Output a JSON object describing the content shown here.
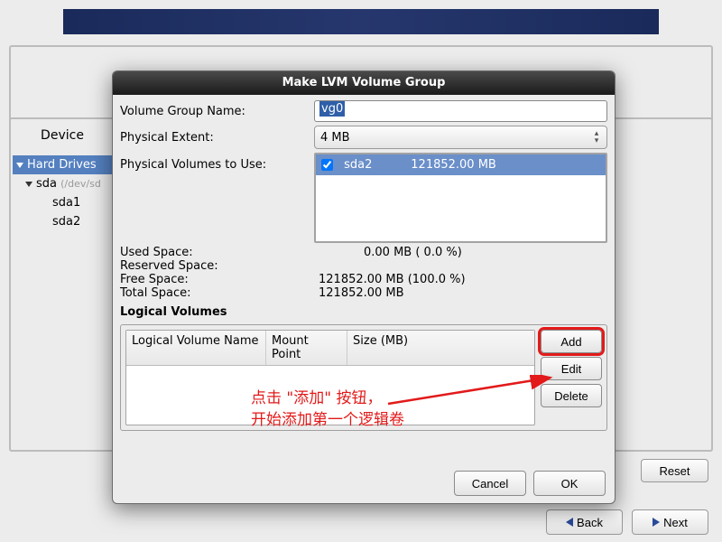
{
  "device_header": "Device",
  "tree": {
    "hard_drives": "Hard Drives",
    "sda": "sda",
    "sda_dev": "(/dev/sd",
    "sda1": "sda1",
    "sda2": "sda2"
  },
  "reset_label": "Reset",
  "back_label": "Back",
  "next_label": "Next",
  "dialog": {
    "title": "Make LVM Volume Group",
    "vg_name_label": "Volume Group Name:",
    "vg_name_value": "vg0",
    "pe_label": "Physical Extent:",
    "pe_value": "4 MB",
    "pv_label": "Physical Volumes to Use:",
    "pv_item_name": "sda2",
    "pv_item_size": "121852.00 MB",
    "used_label": "Used Space:",
    "used_value": "0.00 MB  ( 0.0 %)",
    "reserved_label": "Reserved Space:",
    "free_label": "Free Space:",
    "free_value": "121852.00 MB  (100.0 %)",
    "total_label": "Total Space:",
    "total_value": "121852.00 MB",
    "lv_heading": "Logical Volumes",
    "lv_col_name": "Logical Volume Name",
    "lv_col_mount": "Mount Point",
    "lv_col_size": "Size (MB)",
    "add_label": "Add",
    "edit_label": "Edit",
    "delete_label": "Delete",
    "cancel_label": "Cancel",
    "ok_label": "OK"
  },
  "annotation_line1": "点击 \"添加\" 按钮，",
  "annotation_line2": "开始添加第一个逻辑卷"
}
